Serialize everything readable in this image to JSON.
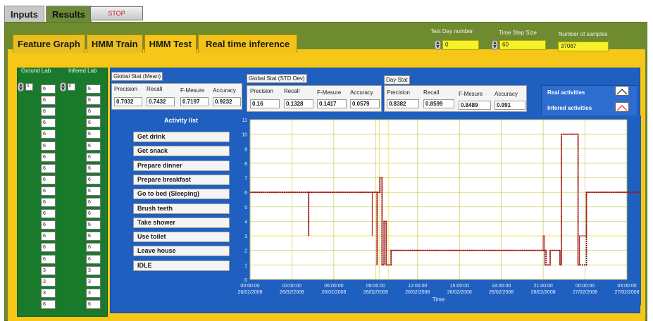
{
  "tabs": {
    "inputs": "Inputs",
    "results": "Results"
  },
  "stop_label": "STOP",
  "subtabs": [
    "Feature Graph",
    "HMM Train",
    "HMM Test",
    "Real time inference"
  ],
  "controls": {
    "test_day_label": "Test Day number",
    "test_day_value": "0",
    "time_step_label": "Time Step Size",
    "time_step_value": "60",
    "samples_label": "Number of samples",
    "samples_value": "37087"
  },
  "ground_lab": {
    "title": "Ground Lab",
    "index": "0",
    "values": [
      "6",
      "6",
      "6",
      "6",
      "6",
      "6",
      "6",
      "6",
      "6",
      "6",
      "6",
      "6",
      "6",
      "6",
      "6",
      "6",
      "3",
      "3",
      "3",
      "6"
    ]
  },
  "infered_lab": {
    "title": "Infered Lab",
    "index": "0",
    "values": [
      "6",
      "6",
      "6",
      "6",
      "6",
      "6",
      "6",
      "6",
      "6",
      "6",
      "6",
      "6",
      "6",
      "6",
      "6",
      "6",
      "3",
      "3",
      "3",
      "6"
    ]
  },
  "stats": {
    "headers": [
      "Precision",
      "Recall",
      "F-Mesure",
      "Accuracy"
    ],
    "mean": {
      "title": "Global Stat (Mean)",
      "values": [
        "0.7032",
        "0.7432",
        "0.7197",
        "0.9232"
      ]
    },
    "std": {
      "title": "Global Stat (STD Dev)",
      "values": [
        "0.16",
        "0.1328",
        "0.1417",
        "0.0579"
      ]
    },
    "day": {
      "title": "Day Stat",
      "values": [
        "0.8382",
        "0.8599",
        "0.8489",
        "0.991"
      ]
    }
  },
  "legend": {
    "real": "Real activities",
    "infered": "Infered activities",
    "real_color": "#202020",
    "infered_color": "#e02020"
  },
  "activity_list": {
    "title": "Activity list",
    "items": [
      "Get drink",
      "Get snack",
      "Prepare dinner",
      "Prepare breakfast",
      "Go to bed (Sleeping)",
      "Brush teeth",
      "Take shower",
      "Use toilet",
      "Leave house",
      "IDLE"
    ]
  },
  "chart_data": {
    "type": "line",
    "xlabel": "Time",
    "ylim": [
      0,
      11
    ],
    "y_ticks": [
      "0",
      "1",
      "2",
      "3",
      "4",
      "5",
      "6",
      "7",
      "8",
      "9",
      "10",
      "11"
    ],
    "x_ticks": [
      {
        "time": "00:00:00",
        "date": "26/02/2008"
      },
      {
        "time": "03:00:00",
        "date": "26/02/2008"
      },
      {
        "time": "06:00:00",
        "date": "26/02/2008"
      },
      {
        "time": "09:00:00",
        "date": "26/02/2008"
      },
      {
        "time": "12:00:00",
        "date": "26/02/2008"
      },
      {
        "time": "15:00:00",
        "date": "26/02/2008"
      },
      {
        "time": "18:00:00",
        "date": "26/02/2008"
      },
      {
        "time": "21:00:00",
        "date": "26/02/2008"
      },
      {
        "time": "00:00:00",
        "date": "27/02/2008"
      },
      {
        "time": "03:00:00",
        "date": "27/02/2008"
      }
    ],
    "grid": true,
    "series": [
      {
        "name": "Real activities",
        "color": "#5a1010",
        "x_hours": [
          0,
          4.2,
          4.2,
          4.2,
          4.2,
          9.1,
          9.1,
          9.1,
          9.3,
          9.3,
          9.45,
          9.45,
          9.6,
          9.6,
          9.75,
          9.75,
          10.1,
          10.1,
          21.2,
          21.2,
          21.5,
          21.5,
          22.2,
          22.2,
          22.3,
          22.3,
          23.5,
          23.5,
          24.1,
          24.1,
          28.8
        ],
        "values": [
          6,
          6,
          3,
          3,
          6,
          6,
          1,
          6,
          6,
          7,
          7,
          1,
          1,
          4,
          4,
          1,
          1,
          2,
          2,
          1,
          1,
          2,
          2,
          1,
          1,
          10,
          10,
          1,
          1,
          6,
          6
        ]
      },
      {
        "name": "Infered activities",
        "color": "#c01818",
        "x_hours": [
          0,
          4.2,
          4.2,
          4.2,
          4.2,
          8.75,
          8.75,
          8.75,
          8.75,
          9.1,
          9.1,
          9.1,
          9.3,
          9.3,
          9.45,
          9.45,
          9.6,
          9.6,
          9.75,
          9.75,
          10.1,
          10.1,
          21.0,
          21.0,
          21.1,
          21.1,
          21.5,
          21.5,
          22.2,
          22.2,
          22.3,
          22.3,
          23.5,
          23.5,
          23.6,
          23.6,
          24.1,
          24.1,
          28.8
        ],
        "values": [
          6,
          6,
          3,
          3,
          6,
          6,
          3,
          3,
          6,
          6,
          1,
          6,
          6,
          7,
          7,
          1,
          1,
          4,
          4,
          1,
          1,
          2,
          2,
          3,
          3,
          1,
          1,
          2,
          2,
          1,
          1,
          10,
          10,
          1,
          1,
          3,
          3,
          6,
          6
        ]
      }
    ],
    "markers": {
      "x_hours": [
        9.25,
        9.9
      ],
      "y_values": [
        3,
        3
      ]
    }
  }
}
